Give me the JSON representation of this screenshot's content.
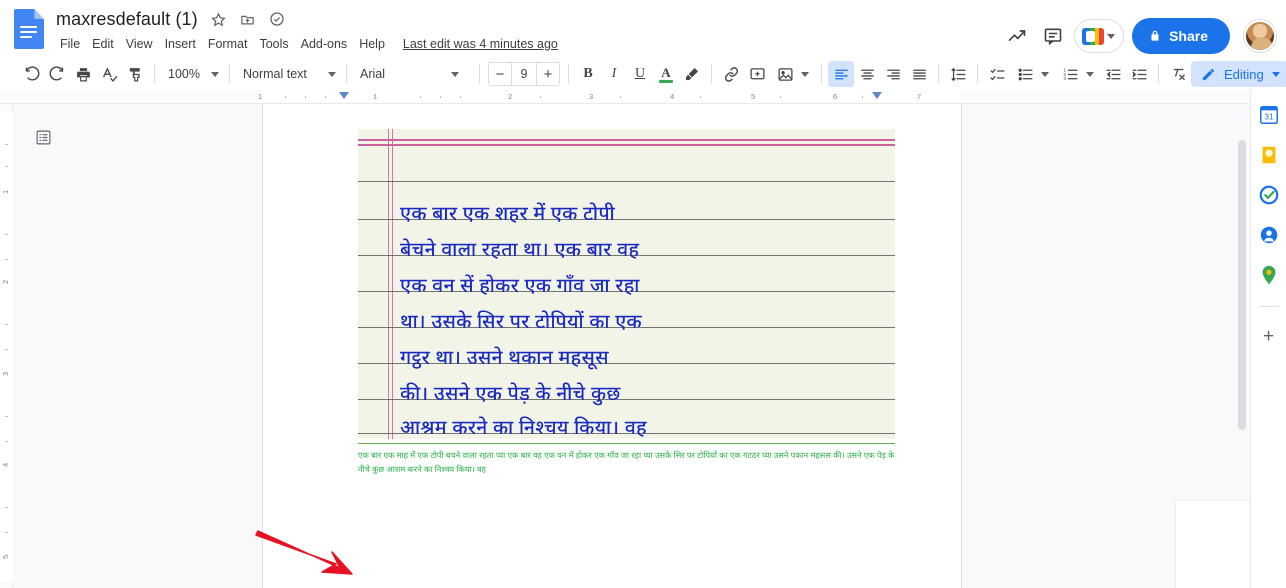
{
  "app": {
    "name": "Google Docs",
    "logo_icon": "docs-logo-icon"
  },
  "header": {
    "doc_title": "maxresdefault (1)",
    "title_icons": [
      {
        "name": "star-icon",
        "glyph": "☆"
      },
      {
        "name": "move-to-folder-icon",
        "glyph": "❐"
      },
      {
        "name": "cloud-saved-icon",
        "glyph": "☁"
      }
    ],
    "menu": [
      "File",
      "Edit",
      "View",
      "Insert",
      "Format",
      "Tools",
      "Add-ons",
      "Help"
    ],
    "last_edit": "Last edit was 4 minutes ago",
    "activity_icon": "activity-dashboard-icon",
    "comments_icon": "comment-history-icon",
    "meet_label": "meet-icon",
    "share_label": "Share",
    "share_lock_icon": "lock-icon",
    "share_color": "#1a73e8",
    "avatar_name": "user-avatar"
  },
  "toolbar": {
    "undo": "undo-icon",
    "redo": "redo-icon",
    "print": "print-icon",
    "spelling": "spell-check-icon",
    "paint_format": "paint-format-icon",
    "zoom_value": "100%",
    "style_value": "Normal text",
    "font_value": "Arial",
    "font_size": "9",
    "font_decrease": "−",
    "font_increase": "+",
    "bold": "B",
    "italic": "I",
    "underline": "U",
    "text_color_letter": "A",
    "text_color_value": "#34a853",
    "highlight": "highlight-icon",
    "insert_link": "link-icon",
    "add_comment": "add-comment-icon",
    "insert_image": "insert-image-icon",
    "align_left": "align-left-icon",
    "align_center": "align-center-icon",
    "align_right": "align-right-icon",
    "align_justify": "align-justify-icon",
    "line_spacing": "line-spacing-icon",
    "checklist": "checklist-icon",
    "bulleted_list": "bulleted-list-icon",
    "numbered_list": "numbered-list-icon",
    "decrease_indent": "decrease-indent-icon",
    "increase_indent": "increase-indent-icon",
    "clear_formatting": "clear-formatting-icon",
    "mode_label": "Editing",
    "mode_icon": "pencil-icon",
    "collapse_icon": "collapse-toolbar-icon"
  },
  "ruler": {
    "horizontal_marks": [
      "1",
      "1",
      "2",
      "3",
      "4",
      "5",
      "6",
      "7"
    ],
    "vertical_marks": [
      "1",
      "2",
      "3",
      "4",
      "5"
    ],
    "left_indent_marker": "left-indent-marker",
    "right_indent_marker": "right-indent-marker"
  },
  "workspace": {
    "outline_icon": "document-outline-icon",
    "scrollbar": "vertical-scrollbar"
  },
  "document": {
    "image_alt": "handwritten-hindi-notebook-scan",
    "handwriting_lines": [
      "एक  बार  एक  शहर  में  एक  टोपी",
      "बेचने  वाला  रहता  था। एक  बार  वह",
      "एक  वन  सें  होकर  एक  गाँव  जा  रहा",
      "था। उसके  सिर  पर  टोपियों  का  एक",
      "गट्ठर  था। उसने  थकान  महसूस",
      "की। उसने  एक  पेड़  के  नीचे  कुछ",
      "आश्रम  करने  का  निश्चय  किया। वह"
    ],
    "extracted_text": "एक बार एक माह में एक टोपी बचने वाला रहता प्या एक बार वह एक वन में होकर एक गाँव जा रहा प्या उसके सिर पर टोपियों का एक गटठर प्या उसने पकान महसस की। उसने एक पेड़ के नीचे कुछ आशम करने का निश्वय किया। वह",
    "extracted_text_color": "#2bb24c",
    "annotation_arrow": "red-arrow-annotation",
    "annotation_arrow_color": "#e81123"
  },
  "sidebar_right": {
    "items": [
      {
        "name": "google-calendar-icon"
      },
      {
        "name": "google-keep-icon"
      },
      {
        "name": "google-tasks-icon"
      },
      {
        "name": "google-contacts-icon"
      },
      {
        "name": "google-maps-icon"
      }
    ],
    "add_ons_label": "+"
  }
}
